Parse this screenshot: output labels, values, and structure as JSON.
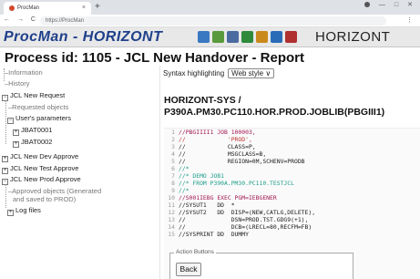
{
  "browser": {
    "tab_title": "ProcMan",
    "tab_close": "×",
    "new_tab": "+",
    "url": "https://ProcMan",
    "nav_glyphs": "← → C",
    "win_min": "—",
    "win_max": "□",
    "win_close": "✕"
  },
  "header": {
    "app_title": "ProcMan - HORIZONT",
    "brand": "HORIZONT",
    "toolbar_icons": [
      {
        "name": "screen-icon",
        "color": "#3a78c2"
      },
      {
        "name": "grid-icon",
        "color": "#5a9a3c"
      },
      {
        "name": "print-icon",
        "color": "#4a6aa0"
      },
      {
        "name": "car-icon",
        "color": "#2f8a3a"
      },
      {
        "name": "home-icon",
        "color": "#c98a1a"
      },
      {
        "name": "globe-icon",
        "color": "#2a6bb8"
      },
      {
        "name": "user-icon",
        "color": "#b03030"
      }
    ]
  },
  "page": {
    "title": "Process id: 1105 - JCL New Handover - Report"
  },
  "sidebar": {
    "information": "Information",
    "history": "History",
    "jcl_new_request": "JCL New Request",
    "requested_objects": "Requested objects",
    "users_parameters": "User's parameters",
    "jbat0001": "JBAT0001",
    "jbat0002": "JBAT0002",
    "jcl_new_dev_approve": "JCL New Dev Approve",
    "jcl_new_test_approve": "JCL New Test Approve",
    "jcl_new_prod_approve": "JCL New Prod Approve",
    "approved_objects_1": "Approved objects (Generated",
    "approved_objects_2": "and saved to PROD)",
    "log_files": "Log files",
    "expand": "+",
    "collapse": "−"
  },
  "main": {
    "syntax_label": "Syntax highlighting",
    "syntax_value": "Web style ∨",
    "dsn_line1": "HORIZONT-SYS /",
    "dsn_line2": "P390A.PM30.PC110.HOR.PROD.JOBLIB(PBGIII1)",
    "code_lines": [
      {
        "n": "1",
        "t": "//PBGIIII1 JOB 100003,",
        "c": "kw"
      },
      {
        "n": "2",
        "t": "//            'PROD',",
        "c": "str"
      },
      {
        "n": "3",
        "t": "//            CLASS=P,",
        "c": ""
      },
      {
        "n": "4",
        "t": "//            MSGCLASS=B,",
        "c": ""
      },
      {
        "n": "5",
        "t": "//            REGION=0M,SCHENV=PRODB",
        "c": ""
      },
      {
        "n": "6",
        "t": "//*",
        "c": "cmt"
      },
      {
        "n": "7",
        "t": "//* DEMO JOB1",
        "c": "cmt"
      },
      {
        "n": "8",
        "t": "//* FROM P390A.PM30.PC110.TESTJCL",
        "c": "cmt"
      },
      {
        "n": "9",
        "t": "//*",
        "c": "cmt"
      },
      {
        "n": "10",
        "t": "//S001IEBG EXEC PGM=IEBGENER",
        "c": "kw"
      },
      {
        "n": "11",
        "t": "//SYSUT1   DD  *",
        "c": ""
      },
      {
        "n": "12",
        "t": "//SYSUT2   DD  DISP=(NEW,CATLG,DELETE),",
        "c": ""
      },
      {
        "n": "13",
        "t": "//             DSN=PROD.TST.GDG9(+1),",
        "c": ""
      },
      {
        "n": "14",
        "t": "//             DCB=(LRECL=80,RECFM=FB)",
        "c": ""
      },
      {
        "n": "15",
        "t": "//SYSPRINT DD  DUMMY",
        "c": ""
      }
    ],
    "action_legend": "Action Buttons",
    "back_label": "Back"
  }
}
